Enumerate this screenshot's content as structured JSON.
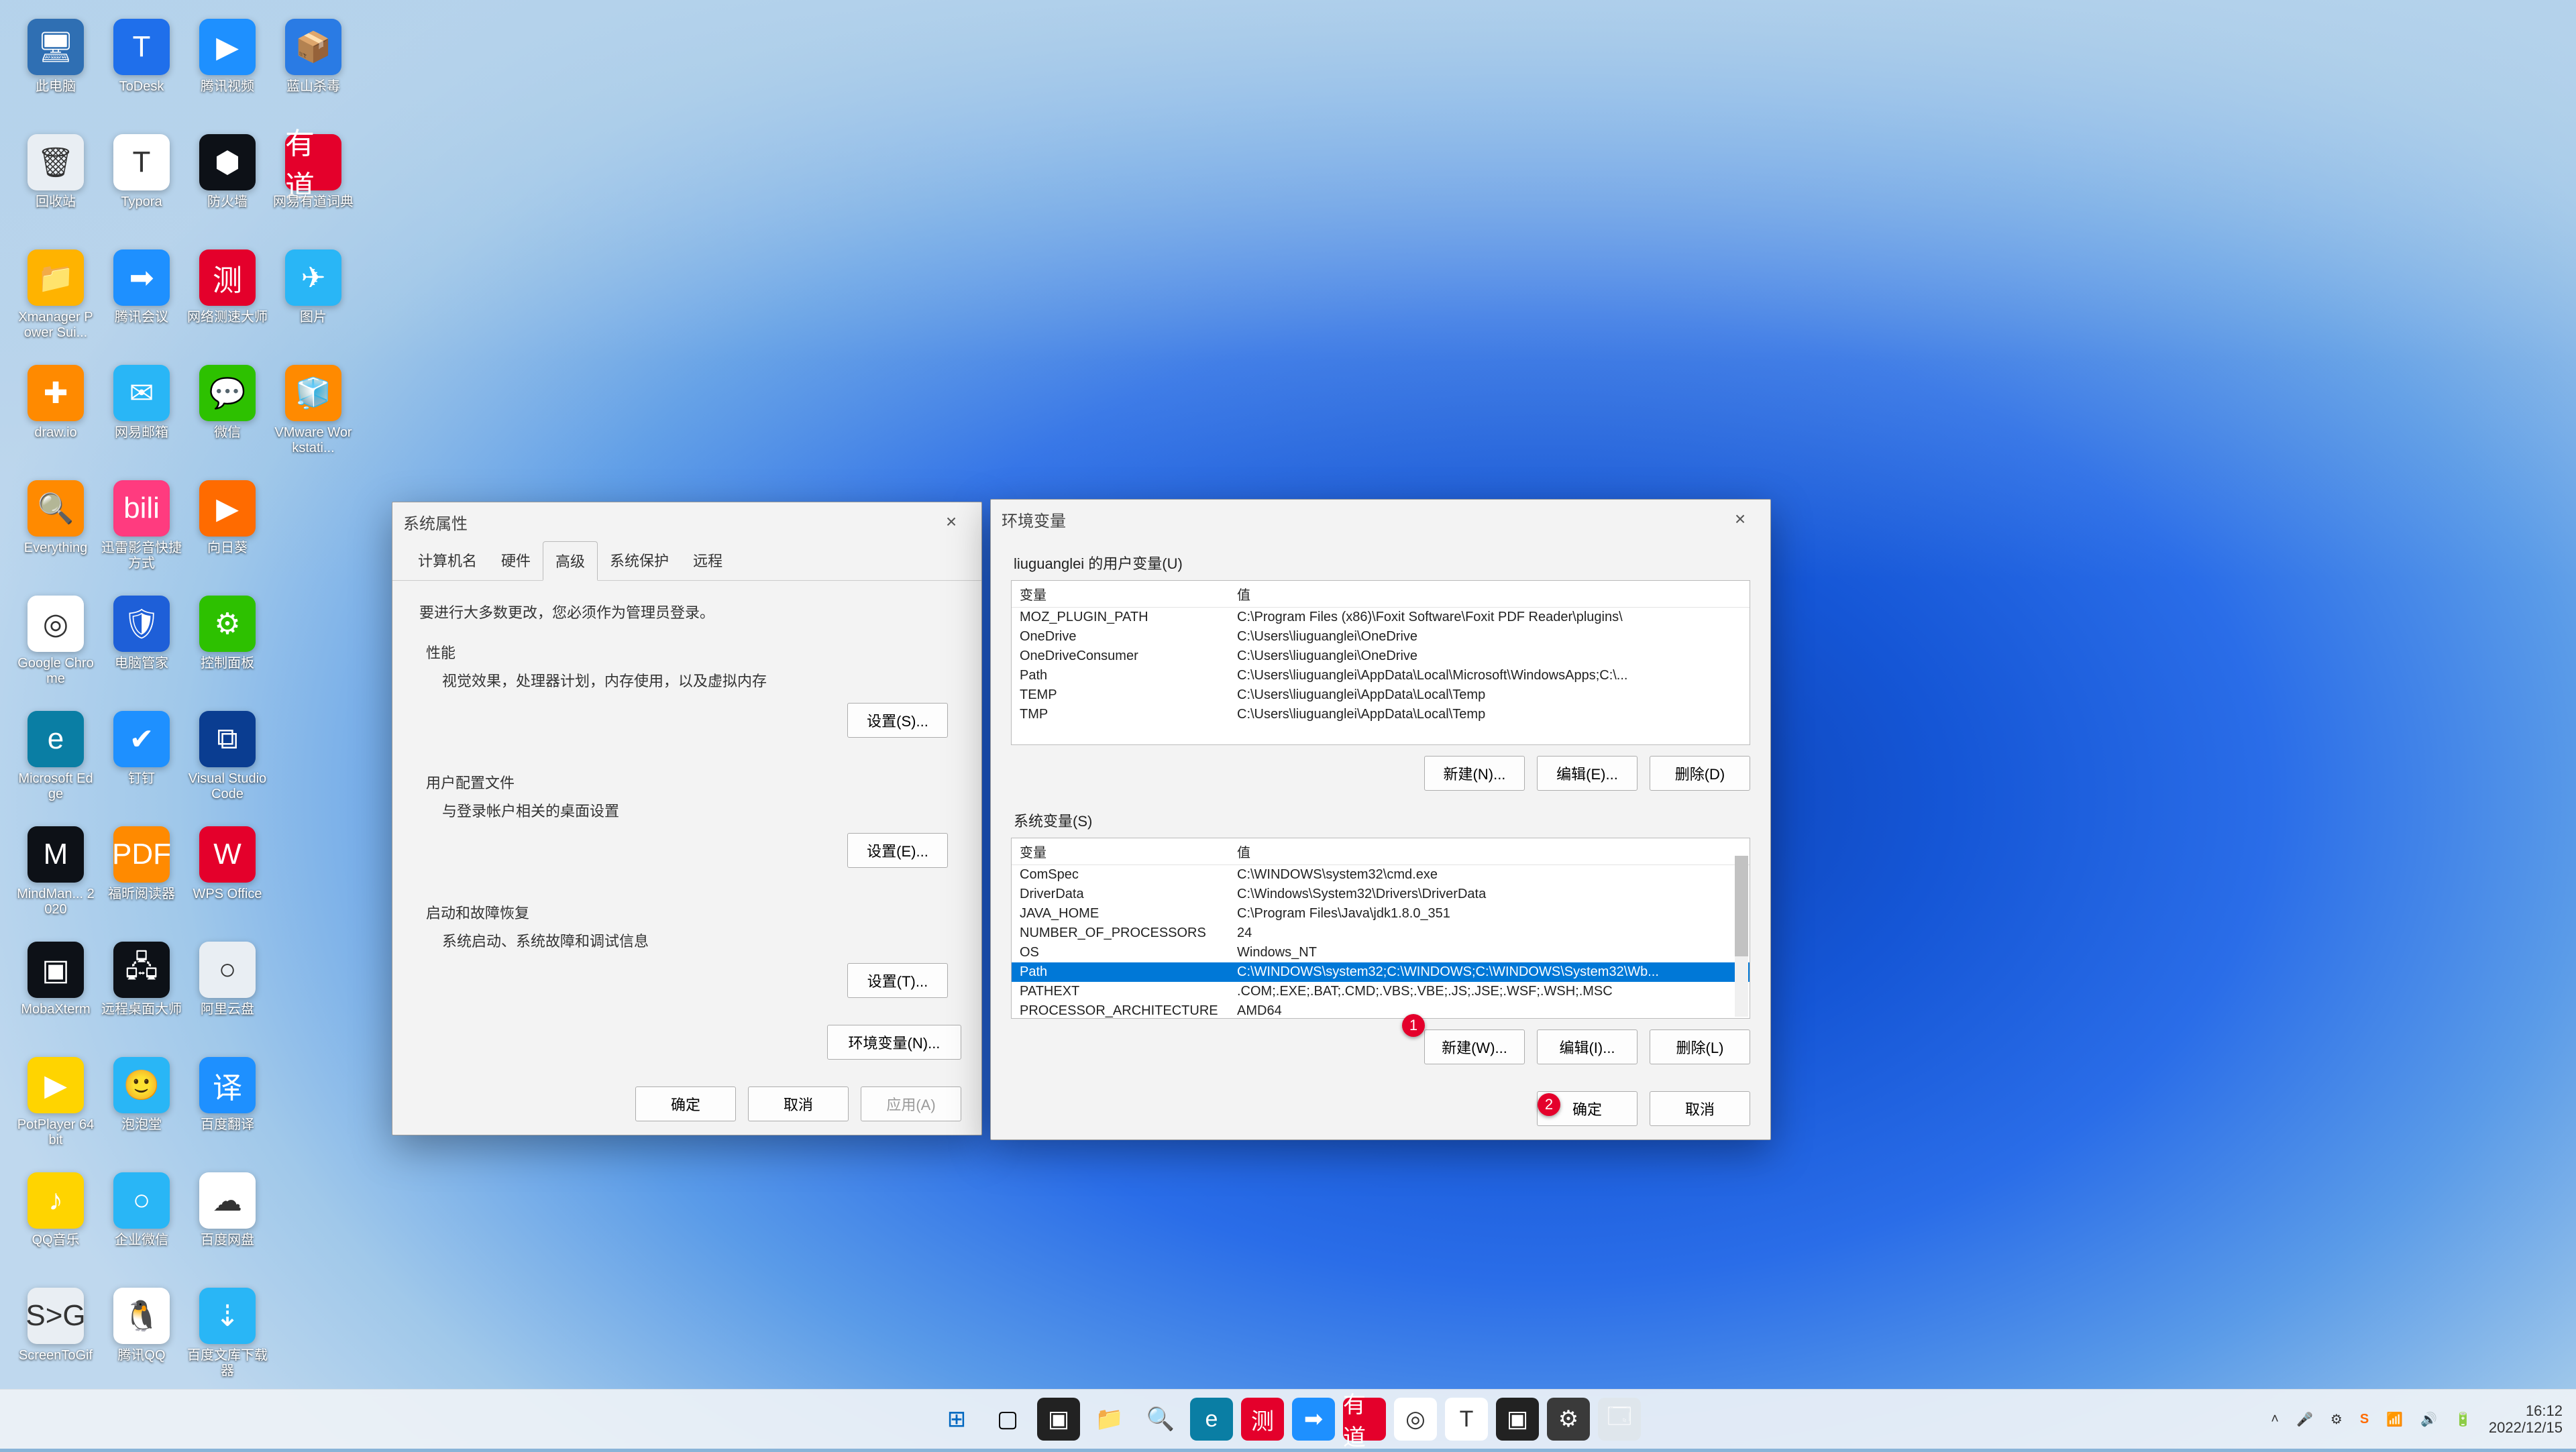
{
  "desktop_icons": [
    {
      "label": "此电脑",
      "bg": "#2f6fb3",
      "glyph": "🖥"
    },
    {
      "label": "ToDesk",
      "bg": "#1f6feb",
      "glyph": "T"
    },
    {
      "label": "腾讯视频",
      "bg": "#1e90ff",
      "glyph": "▶"
    },
    {
      "label": "蓝山杀毒",
      "bg": "#2a7be4",
      "glyph": "📦"
    },
    {
      "label": "回收站",
      "bg": "#e9eef3",
      "glyph": "🗑"
    },
    {
      "label": "Typora",
      "bg": "#ffffff",
      "glyph": "T"
    },
    {
      "label": "防火墙",
      "bg": "#0d1117",
      "glyph": "⬢"
    },
    {
      "label": "网易有道词典",
      "bg": "#e4002b",
      "glyph": "有道"
    },
    {
      "label": "Xmanager Power Sui...",
      "bg": "#ffb300",
      "glyph": "📁"
    },
    {
      "label": "腾讯会议",
      "bg": "#1e90ff",
      "glyph": "➡"
    },
    {
      "label": "网络测速大师",
      "bg": "#e4002b",
      "glyph": "测"
    },
    {
      "label": "图片",
      "bg": "#29b6f6",
      "glyph": "✈"
    },
    {
      "label": "draw.io",
      "bg": "#ff8a00",
      "glyph": "✚"
    },
    {
      "label": "网易邮箱",
      "bg": "#29b6f6",
      "glyph": "✉"
    },
    {
      "label": "微信",
      "bg": "#2dc100",
      "glyph": "💬"
    },
    {
      "label": "VMware Workstati...",
      "bg": "#ff8a00",
      "glyph": "🧊"
    },
    {
      "label": "Everything",
      "bg": "#ff8a00",
      "glyph": "🔍"
    },
    {
      "label": "迅雷影音快捷方式",
      "bg": "#ff3b7f",
      "glyph": "bili"
    },
    {
      "label": "向日葵",
      "bg": "#ff6b00",
      "glyph": "▶"
    },
    {
      "label": "",
      "bg": "transparent",
      "glyph": ""
    },
    {
      "label": "Google Chrome",
      "bg": "#ffffff",
      "glyph": "◎"
    },
    {
      "label": "电脑管家",
      "bg": "#1e5fd8",
      "glyph": "🛡"
    },
    {
      "label": "控制面板",
      "bg": "#2dc100",
      "glyph": "⚙"
    },
    {
      "label": "",
      "bg": "transparent",
      "glyph": ""
    },
    {
      "label": "Microsoft Edge",
      "bg": "#0a7ea4",
      "glyph": "e"
    },
    {
      "label": "钉钉",
      "bg": "#1e90ff",
      "glyph": "✔"
    },
    {
      "label": "Visual Studio Code",
      "bg": "#0a3d91",
      "glyph": "⧉"
    },
    {
      "label": "",
      "bg": "transparent",
      "glyph": ""
    },
    {
      "label": "MindMan... 2020",
      "bg": "#0d1117",
      "glyph": "M"
    },
    {
      "label": "福昕阅读器",
      "bg": "#ff8a00",
      "glyph": "PDF"
    },
    {
      "label": "WPS Office",
      "bg": "#e4002b",
      "glyph": "W"
    },
    {
      "label": "",
      "bg": "transparent",
      "glyph": ""
    },
    {
      "label": "MobaXterm",
      "bg": "#0d1117",
      "glyph": "▣"
    },
    {
      "label": "远程桌面大师",
      "bg": "#0d1117",
      "glyph": "🖧"
    },
    {
      "label": "阿里云盘",
      "bg": "#e9eef3",
      "glyph": "○"
    },
    {
      "label": "",
      "bg": "transparent",
      "glyph": ""
    },
    {
      "label": "PotPlayer 64 bit",
      "bg": "#ffd400",
      "glyph": "▶"
    },
    {
      "label": "泡泡堂",
      "bg": "#29b6f6",
      "glyph": "🙂"
    },
    {
      "label": "百度翻译",
      "bg": "#1e90ff",
      "glyph": "译"
    },
    {
      "label": "",
      "bg": "transparent",
      "glyph": ""
    },
    {
      "label": "QQ音乐",
      "bg": "#ffd400",
      "glyph": "♪"
    },
    {
      "label": "企业微信",
      "bg": "#29b6f6",
      "glyph": "○"
    },
    {
      "label": "百度网盘",
      "bg": "#ffffff",
      "glyph": "☁"
    },
    {
      "label": "",
      "bg": "transparent",
      "glyph": ""
    },
    {
      "label": "ScreenToGif",
      "bg": "#e9eef3",
      "glyph": "S>G"
    },
    {
      "label": "腾讯QQ",
      "bg": "#ffffff",
      "glyph": "🐧"
    },
    {
      "label": "百度文库下载器",
      "bg": "#29b6f6",
      "glyph": "⇣"
    },
    {
      "label": "",
      "bg": "transparent",
      "glyph": ""
    }
  ],
  "sysprops": {
    "title": "系统属性",
    "tabs": [
      "计算机名",
      "硬件",
      "高级",
      "系统保护",
      "远程"
    ],
    "active_tab": 2,
    "admin_note": "要进行大多数更改，您必须作为管理员登录。",
    "perf": {
      "title": "性能",
      "desc": "视觉效果，处理器计划，内存使用，以及虚拟内存",
      "btn": "设置(S)..."
    },
    "profile": {
      "title": "用户配置文件",
      "desc": "与登录帐户相关的桌面设置",
      "btn": "设置(E)..."
    },
    "startup": {
      "title": "启动和故障恢复",
      "desc": "系统启动、系统故障和调试信息",
      "btn": "设置(T)..."
    },
    "envbtn": "环境变量(N)...",
    "ok": "确定",
    "cancel": "取消",
    "apply": "应用(A)"
  },
  "env": {
    "title": "环境变量",
    "user_section": "liuguanglei 的用户变量(U)",
    "sys_section": "系统变量(S)",
    "cols": {
      "var": "变量",
      "val": "值"
    },
    "user_vars": [
      {
        "var": "MOZ_PLUGIN_PATH",
        "val": "C:\\Program Files (x86)\\Foxit Software\\Foxit PDF Reader\\plugins\\"
      },
      {
        "var": "OneDrive",
        "val": "C:\\Users\\liuguanglei\\OneDrive"
      },
      {
        "var": "OneDriveConsumer",
        "val": "C:\\Users\\liuguanglei\\OneDrive"
      },
      {
        "var": "Path",
        "val": "C:\\Users\\liuguanglei\\AppData\\Local\\Microsoft\\WindowsApps;C:\\..."
      },
      {
        "var": "TEMP",
        "val": "C:\\Users\\liuguanglei\\AppData\\Local\\Temp"
      },
      {
        "var": "TMP",
        "val": "C:\\Users\\liuguanglei\\AppData\\Local\\Temp"
      }
    ],
    "sys_vars": [
      {
        "var": "ComSpec",
        "val": "C:\\WINDOWS\\system32\\cmd.exe"
      },
      {
        "var": "DriverData",
        "val": "C:\\Windows\\System32\\Drivers\\DriverData"
      },
      {
        "var": "JAVA_HOME",
        "val": "C:\\Program Files\\Java\\jdk1.8.0_351"
      },
      {
        "var": "NUMBER_OF_PROCESSORS",
        "val": "24"
      },
      {
        "var": "OS",
        "val": "Windows_NT"
      },
      {
        "var": "Path",
        "val": "C:\\WINDOWS\\system32;C:\\WINDOWS;C:\\WINDOWS\\System32\\Wb..."
      },
      {
        "var": "PATHEXT",
        "val": ".COM;.EXE;.BAT;.CMD;.VBS;.VBE;.JS;.JSE;.WSF;.WSH;.MSC"
      },
      {
        "var": "PROCESSOR_ARCHITECTURE",
        "val": "AMD64"
      }
    ],
    "sys_selected": 5,
    "user_btns": {
      "new": "新建(N)...",
      "edit": "编辑(E)...",
      "del": "删除(D)"
    },
    "sys_btns": {
      "new": "新建(W)...",
      "edit": "编辑(I)...",
      "del": "删除(L)"
    },
    "ok": "确定",
    "cancel": "取消"
  },
  "annotations": {
    "1": "1",
    "2": "2"
  },
  "taskbar": {
    "icons": [
      {
        "name": "start",
        "glyph": "⊞",
        "bg": "transparent",
        "color": "#0067c0"
      },
      {
        "name": "taskview",
        "glyph": "▢",
        "bg": "transparent"
      },
      {
        "name": "terminal",
        "glyph": "▣",
        "bg": "#222"
      },
      {
        "name": "explorer",
        "glyph": "📁",
        "bg": "transparent"
      },
      {
        "name": "search",
        "glyph": "🔍",
        "bg": "transparent",
        "color": "#d98a00"
      },
      {
        "name": "edge",
        "glyph": "e",
        "bg": "#0a7ea4"
      },
      {
        "name": "netspeed",
        "glyph": "测",
        "bg": "#e4002b"
      },
      {
        "name": "tencent",
        "glyph": "➡",
        "bg": "#1e90ff"
      },
      {
        "name": "youdao",
        "glyph": "有道",
        "bg": "#e4002b"
      },
      {
        "name": "chrome",
        "glyph": "◎",
        "bg": "#fff"
      },
      {
        "name": "typora",
        "glyph": "T",
        "bg": "#fff"
      },
      {
        "name": "cmd",
        "glyph": "▣",
        "bg": "#222"
      },
      {
        "name": "settings",
        "glyph": "⚙",
        "bg": "#3a3a3a"
      },
      {
        "name": "sysprops-task",
        "glyph": "🗔",
        "bg": "#dfe6ec"
      }
    ]
  },
  "tray": {
    "chevron": "˄",
    "mic": "🎤",
    "gear": "⚙",
    "sogou": "S",
    "wifi": "📶",
    "vol": "🔊",
    "bat": "🔋"
  },
  "clock": {
    "time": "16:12",
    "date": "2022/12/15"
  }
}
